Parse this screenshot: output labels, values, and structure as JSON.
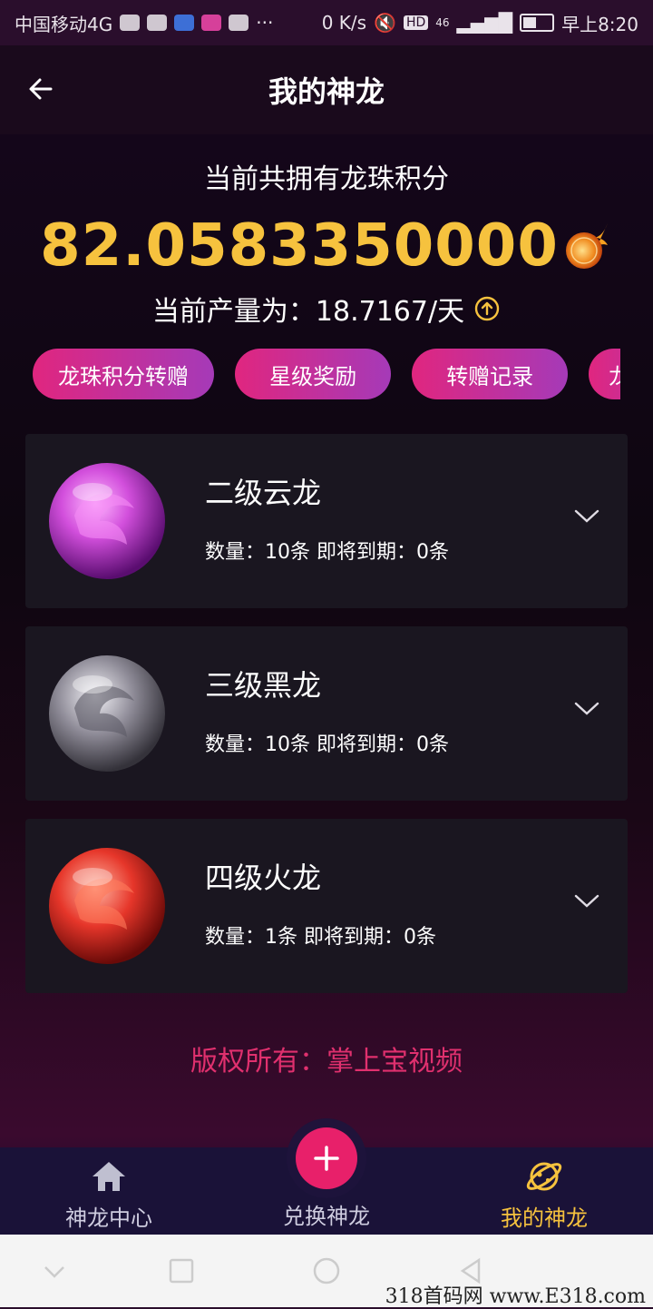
{
  "status_bar": {
    "carrier": "中国移动4G",
    "speed": "0 K/s",
    "hd": "HD",
    "network": "46",
    "time": "早上8:20"
  },
  "nav": {
    "title": "我的神龙"
  },
  "summary": {
    "label": "当前共拥有龙珠积分",
    "points": "82.0583350000",
    "rate_label": "当前产量为：18.7167/天"
  },
  "actions": [
    {
      "label": "龙珠积分转赠"
    },
    {
      "label": "星级奖励"
    },
    {
      "label": "转赠记录"
    },
    {
      "label": "龙"
    }
  ],
  "dragons": [
    {
      "name": "二级云龙",
      "detail": "数量：10条   即将到期：0条",
      "color": "#c43fd0"
    },
    {
      "name": "三级黑龙",
      "detail": "数量：10条   即将到期：0条",
      "color": "#8c8a96"
    },
    {
      "name": "四级火龙",
      "detail": "数量：1条   即将到期：0条",
      "color": "#e0302a"
    }
  ],
  "copyright": "版权所有：掌上宝视频",
  "tabs": [
    {
      "label": "神龙中心",
      "icon": "home-icon"
    },
    {
      "label": "兑换神龙",
      "icon": "plus-icon"
    },
    {
      "label": "我的神龙",
      "icon": "planet-icon",
      "active": true
    }
  ],
  "watermark": "318首码网  www.E318.com",
  "colors": {
    "accent_gold": "#f6c23e",
    "pill_gradient_start": "#e0267f",
    "pill_gradient_end": "#a53ab8",
    "fab": "#e8206a",
    "copyright": "#e0306e"
  }
}
